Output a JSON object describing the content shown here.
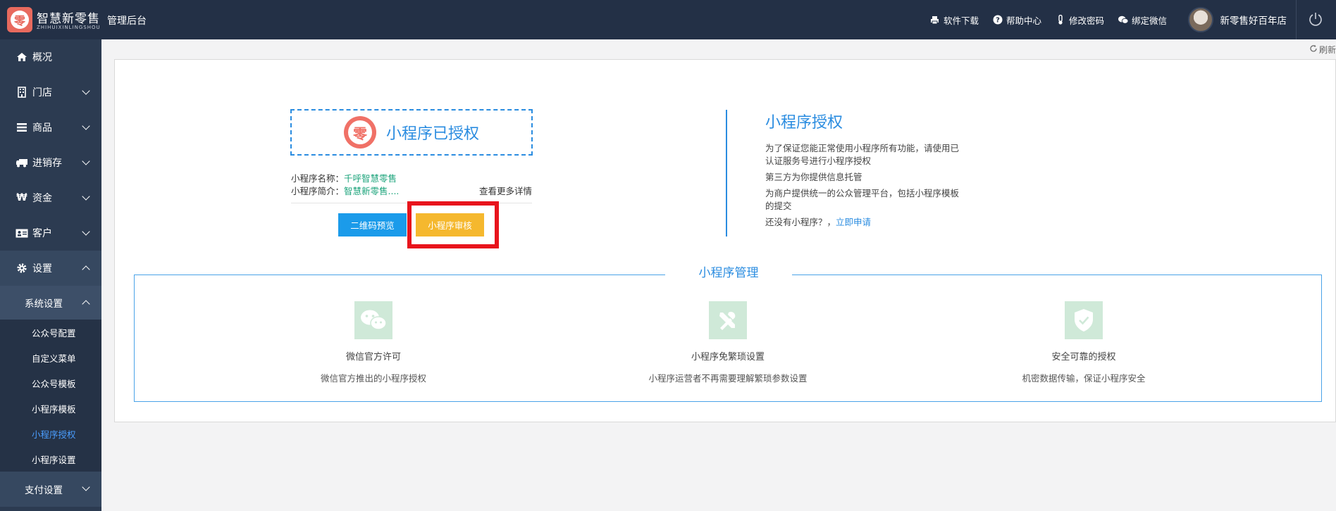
{
  "header": {
    "brand": "智慧新零售",
    "brand_sub": "ZHIHUIXINLINGSHOU",
    "logo_mark": "零",
    "title": "管理后台",
    "actions": [
      {
        "label": "软件下载",
        "icon": "printer-icon"
      },
      {
        "label": "帮助中心",
        "icon": "help-icon"
      },
      {
        "label": "修改密码",
        "icon": "thermometer-icon"
      },
      {
        "label": "绑定微信",
        "icon": "wechat-icon"
      }
    ],
    "user_name": "新零售好百年店"
  },
  "sidebar": {
    "items": [
      {
        "label": "概况",
        "icon": "home-icon"
      },
      {
        "label": "门店",
        "icon": "building-icon"
      },
      {
        "label": "商品",
        "icon": "list-icon"
      },
      {
        "label": "进销存",
        "icon": "truck-icon"
      },
      {
        "label": "资金",
        "icon": "won-icon"
      },
      {
        "label": "客户",
        "icon": "id-card-icon"
      },
      {
        "label": "设置",
        "icon": "gear-icon"
      }
    ],
    "sub_head": "系统设置",
    "sub_items": [
      "公众号配置",
      "自定义菜单",
      "公众号模板",
      "小程序模板",
      "小程序授权",
      "小程序设置"
    ],
    "current_sub": "小程序授权",
    "bottom": "支付设置"
  },
  "refresh": "刷新",
  "auth": {
    "logo_mark": "零",
    "title": "小程序已授权",
    "name_label": "小程序名称：",
    "name_value": "千呼智慧零售",
    "desc_label": "小程序简介：",
    "desc_value": "智慧新零售....",
    "more": "查看更多详情",
    "btn_preview": "二维码预览",
    "btn_review": "小程序审核"
  },
  "right": {
    "title": "小程序授权",
    "line1": "为了保证您能正常使用小程序所有功能，请使用已认证服务号进行小程序授权",
    "line2": "第三方为你提供信息托管",
    "line3": "为商户提供统一的公众管理平台，包括小程序模板的提交",
    "line4": "还没有小程序？，",
    "apply": "立即申请"
  },
  "mgmt": {
    "title": "小程序管理",
    "features": [
      {
        "icon": "wechat-icon",
        "title": "微信官方许可",
        "desc": "微信官方推出的小程序授权"
      },
      {
        "icon": "tools-icon",
        "title": "小程序免繁琐设置",
        "desc": "小程序运营者不再需要理解繁琐参数设置"
      },
      {
        "icon": "shield-check-icon",
        "title": "安全可靠的授权",
        "desc": "机密数据传输，保证小程序安全"
      }
    ]
  },
  "colors": {
    "topbar": "#233046",
    "sidebar": "#2c3b51",
    "accent": "#2a8ce0",
    "btn_preview": "#1b9bea",
    "btn_review": "#f5b82e",
    "highlight": "#e8141c",
    "feature_bg": "#cfe9d8"
  }
}
